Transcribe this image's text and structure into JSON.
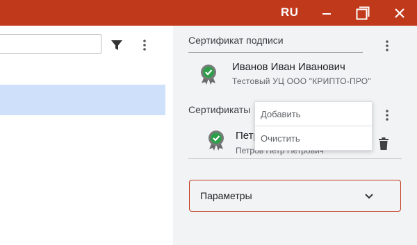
{
  "titlebar": {
    "language": "RU",
    "minimize_icon": "minimize-icon",
    "maximize_icon": "maximize-icon",
    "close_icon": "close-icon",
    "background": "#c0391b"
  },
  "left_pane": {
    "search": {
      "value": "",
      "placeholder": ""
    },
    "filter_icon": "filter-icon",
    "more_icon": "more-vert-icon",
    "selected_row_color": "#cfe0fb"
  },
  "signature_section": {
    "title": "Сертификат подписи",
    "certificate": {
      "name": "Иванов Иван Иванович",
      "issuer": "Тестовый УЦ ООО \"КРИПТО-ПРО\""
    }
  },
  "certificates_section": {
    "title": "Сертификаты",
    "certificate": {
      "name": "Петров Петр Петрович",
      "subtitle": "Петров Петр Петрович"
    }
  },
  "context_menu": {
    "items": [
      "Добавить",
      "Очистить"
    ]
  },
  "parameters": {
    "label": "Параметры",
    "accent": "#c0391b"
  }
}
